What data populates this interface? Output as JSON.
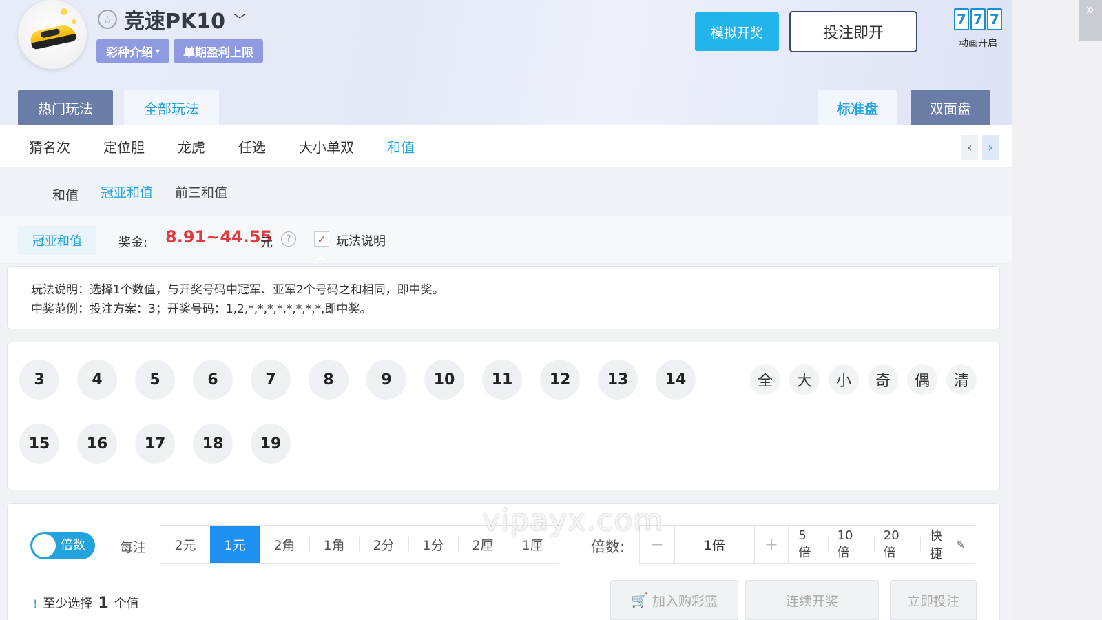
{
  "header": {
    "title": "竞速PK10",
    "tags": [
      "彩种介绍",
      "单期盈利上限"
    ],
    "simulate_label": "模拟开奖",
    "bet_now_label": "投注即开",
    "slot_digits": [
      "7",
      "7",
      "7"
    ],
    "animation_label": "动画开启",
    "main_tabs": [
      "热门玩法",
      "全部玩法"
    ],
    "board_tabs": [
      "标准盘",
      "双面盘"
    ]
  },
  "categories": [
    "猜名次",
    "定位胆",
    "龙虎",
    "任选",
    "大小单双",
    "和值"
  ],
  "active_category": "和值",
  "sub_tabs": [
    "和值",
    "冠亚和值",
    "前三和值"
  ],
  "play": {
    "tag": "冠亚和值",
    "prize_label": "奖金:",
    "prize_value": "8.91~44.55",
    "prize_unit": "元",
    "rules_label": "玩法说明",
    "description_lines": [
      "玩法说明：选择1个数值，与开奖号码中冠军、亚军2个号码之和相同，即中奖。",
      "中奖范例：投注方案：3；开奖号码：1,2,*,*,*,*,*,*,*,*,即中奖。"
    ]
  },
  "numbers": [
    "3",
    "4",
    "5",
    "6",
    "7",
    "8",
    "9",
    "10",
    "11",
    "12",
    "13",
    "14",
    "15",
    "16",
    "17",
    "18",
    "19"
  ],
  "quick_select": [
    "全",
    "大",
    "小",
    "奇",
    "偶",
    "清"
  ],
  "bet": {
    "toggle_label": "倍数",
    "toggle_on": true,
    "per_bet_label": "每注",
    "units": [
      "2元",
      "1元",
      "2角",
      "1角",
      "2分",
      "1分",
      "2厘",
      "1厘"
    ],
    "active_unit": "1元",
    "multiplier_label": "倍数:",
    "minus": "−",
    "multiplier_value": "1倍",
    "plus": "+",
    "presets": [
      "5倍",
      "10倍",
      "20倍"
    ],
    "quick_label": "快捷",
    "notice_prefix": "至少选择",
    "notice_count": "1",
    "notice_suffix": "个值",
    "add_cart": "加入购彩篮",
    "continuous": "连续开奖",
    "place_bet": "立即投注"
  },
  "watermark": "vipayx.com",
  "colors": {
    "accent": "#22a3dc",
    "primary_blue": "#1e90f0",
    "prize_red": "#e23b3b",
    "tab_dark": "#6a7da6",
    "tag_purple": "#8e9be0"
  }
}
